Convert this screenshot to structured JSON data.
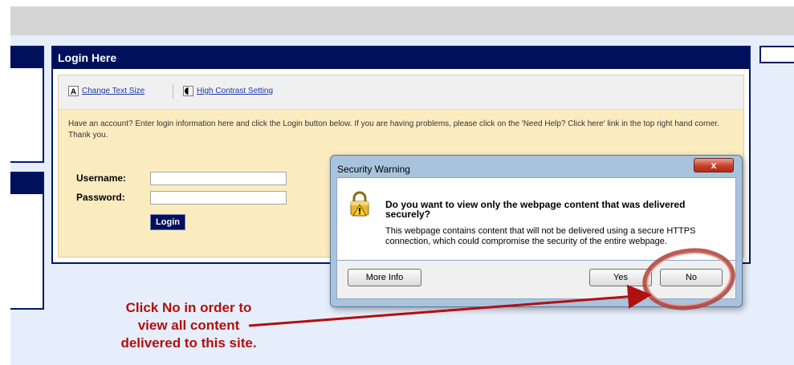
{
  "login": {
    "header": "Login Here",
    "toolbar": {
      "text_size_label": "Change Text Size",
      "contrast_label": "High Contrast Setting"
    },
    "intro_text": "Have an account? Enter login information here and click the Login button below. If you are having problems, please click on the 'Need Help? Click here' link in the top right hand corner. Thank you.",
    "username_label": "Username:",
    "username_value": "",
    "password_label": "Password:",
    "password_value": "",
    "login_button": "Login"
  },
  "dialog": {
    "title": "Security Warning",
    "close_label": "x",
    "question": "Do you want to view only the webpage content that was delivered securely?",
    "message": "This webpage contains content that will not be delivered using a secure HTTPS connection, which could compromise the security of the entire webpage.",
    "more_info_button": "More Info",
    "yes_button": "Yes",
    "no_button": "No"
  },
  "annotation": {
    "line1": "Click No in order to",
    "line2": "view all content",
    "line3": "delivered to this site."
  },
  "colors": {
    "header_navy": "#00105a",
    "form_background": "#fbecc0",
    "annotation_red": "#b11010"
  },
  "icons": {
    "text_size": "text-size-icon",
    "contrast": "contrast-icon",
    "warning": "padlock-warning-icon"
  }
}
